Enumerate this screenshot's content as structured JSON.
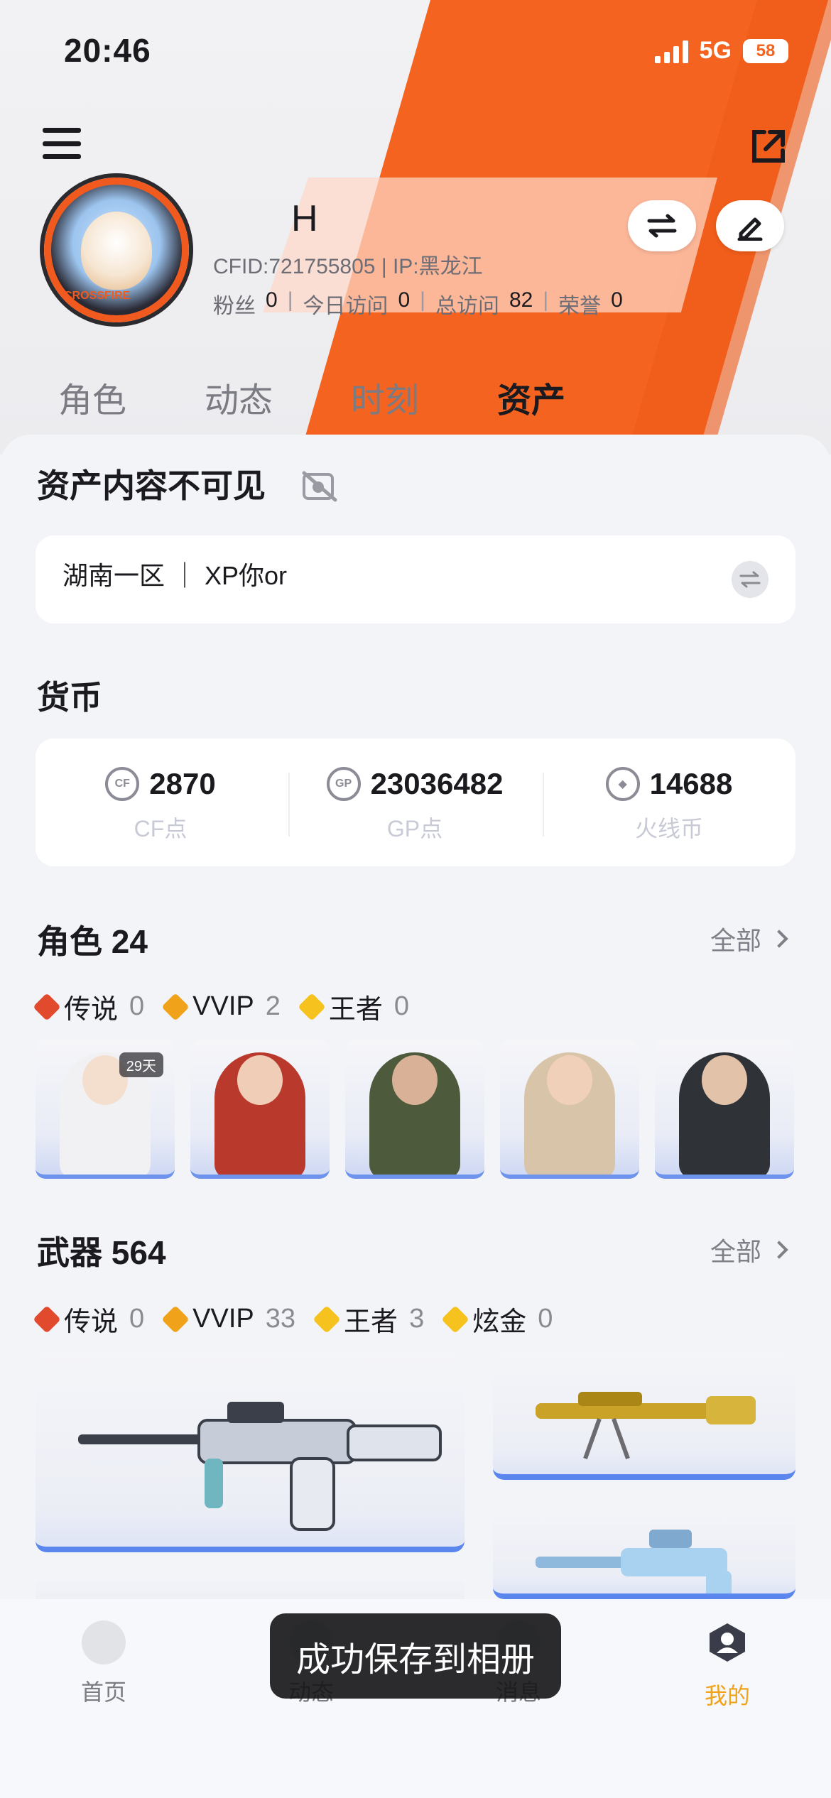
{
  "status_bar": {
    "time": "20:46",
    "network": "5G",
    "battery": "58"
  },
  "profile": {
    "name": "H",
    "cfid_line": "CFID:721755805 | IP:黑龙江",
    "avatar_ring_text": "CROSSFIRE",
    "stats": [
      {
        "label": "粉丝",
        "value": "0"
      },
      {
        "label": "今日访问",
        "value": "0"
      },
      {
        "label": "总访问",
        "value": "82"
      },
      {
        "label": "荣誉",
        "value": "0"
      }
    ]
  },
  "tabs": [
    {
      "label": "角色",
      "active": false
    },
    {
      "label": "动态",
      "active": false
    },
    {
      "label": "时刻",
      "active": false
    },
    {
      "label": "资产",
      "active": true
    }
  ],
  "assets": {
    "visibility_title": "资产内容不可见",
    "server": "湖南一区 ｜ XP你or",
    "currency_title": "货币",
    "currencies": [
      {
        "icon": "cf-coin-icon",
        "value": "2870",
        "label": "CF点"
      },
      {
        "icon": "gp-coin-icon",
        "value": "23036482",
        "label": "GP点"
      },
      {
        "icon": "huoxian-coin-icon",
        "value": "14688",
        "label": "火线币"
      }
    ],
    "characters": {
      "title": "角色 24",
      "see_all": "全部",
      "filters": [
        {
          "label": "传说",
          "count": "0",
          "tier": "legend"
        },
        {
          "label": "VVIP",
          "count": "2",
          "tier": "vvip"
        },
        {
          "label": "王者",
          "count": "0",
          "tier": "king"
        }
      ],
      "cards": [
        {
          "tag": "29天",
          "palette": "#f4f4f6"
        },
        {
          "tag": "",
          "palette": "#b93a2c"
        },
        {
          "tag": "",
          "palette": "#4e5a3c"
        },
        {
          "tag": "",
          "palette": "#d8c4a9"
        },
        {
          "tag": "",
          "palette": "#2f3338"
        }
      ]
    },
    "weapons": {
      "title": "武器 564",
      "see_all": "全部",
      "filters": [
        {
          "label": "传说",
          "count": "0",
          "tier": "legend"
        },
        {
          "label": "VVIP",
          "count": "33",
          "tier": "vvip"
        },
        {
          "label": "王者",
          "count": "3",
          "tier": "king"
        },
        {
          "label": "炫金",
          "count": "0",
          "tier": "gold"
        }
      ]
    }
  },
  "bottom_nav": [
    {
      "label": "首页",
      "active": false
    },
    {
      "label": "动态",
      "active": false
    },
    {
      "label": "消息",
      "active": false
    },
    {
      "label": "我的",
      "active": true
    }
  ],
  "toast": "成功保存到相册",
  "colors": {
    "accent_orange": "#f4631f",
    "active_nav": "#f0a21a",
    "weapon_bar": "#5b86ee"
  }
}
